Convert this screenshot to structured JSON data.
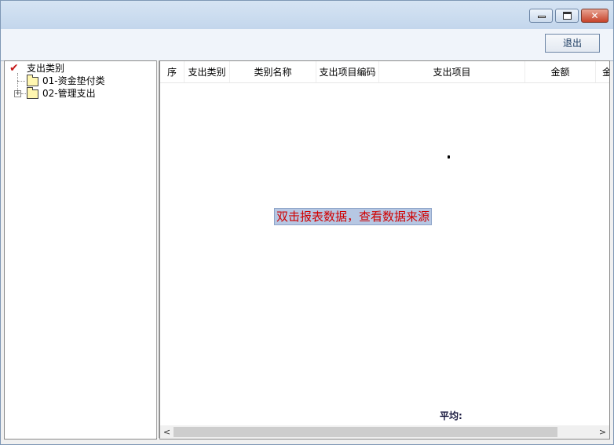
{
  "window": {
    "buttons": {
      "close_glyph": "✕"
    }
  },
  "toolbar": {
    "exit_label": "退出"
  },
  "tree": {
    "root_label": "支出类别",
    "items": [
      {
        "label": "01-资金垫付类",
        "expandable": false
      },
      {
        "label": "02-管理支出",
        "expandable": true
      }
    ]
  },
  "grid": {
    "columns": [
      "序",
      "支出类别",
      "类别名称",
      "支出项目编码",
      "支出项目",
      "金额",
      "金"
    ],
    "hint": "双击报表数据，查看数据来源",
    "footer_label": "平均:"
  },
  "scrollbar": {
    "left_arrow": "<",
    "right_arrow": ">"
  }
}
